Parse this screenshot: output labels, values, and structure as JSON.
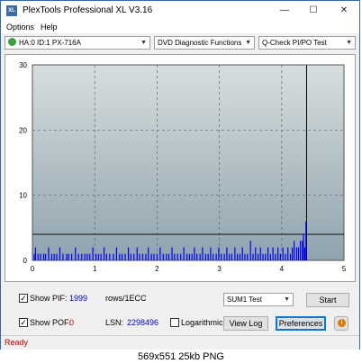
{
  "window": {
    "title": "PlexTools Professional XL V3.16",
    "icon_text": "XL"
  },
  "menu": {
    "options": "Options",
    "help": "Help"
  },
  "toolbar": {
    "drive": "HA:0 ID:1  PX-716A",
    "function": "DVD Diagnostic Functions",
    "test": "Q-Check PI/PO Test"
  },
  "chart_data": {
    "type": "bar",
    "x_ticks": [
      "0",
      "1",
      "2",
      "3",
      "4",
      "5"
    ],
    "y_ticks": [
      "0",
      "10",
      "20",
      "30"
    ],
    "xlim": [
      0,
      5
    ],
    "ylim": [
      0,
      30
    ],
    "grid": true,
    "threshold_line": 4,
    "end_marker_x": 4.4,
    "series": [
      {
        "color": "#0000ff",
        "points": [
          [
            0.03,
            1
          ],
          [
            0.05,
            2
          ],
          [
            0.09,
            1
          ],
          [
            0.13,
            1
          ],
          [
            0.18,
            1
          ],
          [
            0.21,
            1
          ],
          [
            0.26,
            2
          ],
          [
            0.31,
            1
          ],
          [
            0.35,
            1
          ],
          [
            0.39,
            1
          ],
          [
            0.44,
            2
          ],
          [
            0.49,
            1
          ],
          [
            0.55,
            1
          ],
          [
            0.58,
            1
          ],
          [
            0.63,
            1
          ],
          [
            0.69,
            2
          ],
          [
            0.74,
            1
          ],
          [
            0.79,
            1
          ],
          [
            0.84,
            1
          ],
          [
            0.88,
            1
          ],
          [
            0.92,
            1
          ],
          [
            0.97,
            2
          ],
          [
            1.02,
            1
          ],
          [
            1.06,
            1
          ],
          [
            1.1,
            1
          ],
          [
            1.15,
            2
          ],
          [
            1.19,
            1
          ],
          [
            1.24,
            1
          ],
          [
            1.3,
            1
          ],
          [
            1.35,
            2
          ],
          [
            1.4,
            1
          ],
          [
            1.44,
            1
          ],
          [
            1.49,
            1
          ],
          [
            1.54,
            2
          ],
          [
            1.58,
            1
          ],
          [
            1.63,
            1
          ],
          [
            1.68,
            2
          ],
          [
            1.72,
            1
          ],
          [
            1.77,
            1
          ],
          [
            1.82,
            1
          ],
          [
            1.86,
            2
          ],
          [
            1.91,
            1
          ],
          [
            1.95,
            1
          ],
          [
            2.0,
            1
          ],
          [
            2.05,
            2
          ],
          [
            2.1,
            1
          ],
          [
            2.15,
            1
          ],
          [
            2.19,
            1
          ],
          [
            2.24,
            2
          ],
          [
            2.28,
            1
          ],
          [
            2.33,
            1
          ],
          [
            2.38,
            1
          ],
          [
            2.43,
            2
          ],
          [
            2.48,
            1
          ],
          [
            2.52,
            1
          ],
          [
            2.56,
            1
          ],
          [
            2.6,
            2
          ],
          [
            2.64,
            1
          ],
          [
            2.69,
            1
          ],
          [
            2.73,
            2
          ],
          [
            2.78,
            1
          ],
          [
            2.82,
            1
          ],
          [
            2.86,
            2
          ],
          [
            2.9,
            1
          ],
          [
            2.95,
            1
          ],
          [
            2.99,
            2
          ],
          [
            3.03,
            1
          ],
          [
            3.08,
            1
          ],
          [
            3.12,
            2
          ],
          [
            3.16,
            1
          ],
          [
            3.2,
            1
          ],
          [
            3.25,
            2
          ],
          [
            3.29,
            1
          ],
          [
            3.33,
            1
          ],
          [
            3.37,
            2
          ],
          [
            3.41,
            1
          ],
          [
            3.45,
            1
          ],
          [
            3.5,
            3
          ],
          [
            3.54,
            1
          ],
          [
            3.58,
            2
          ],
          [
            3.62,
            1
          ],
          [
            3.66,
            2
          ],
          [
            3.7,
            1
          ],
          [
            3.74,
            1
          ],
          [
            3.78,
            2
          ],
          [
            3.82,
            1
          ],
          [
            3.86,
            2
          ],
          [
            3.9,
            1
          ],
          [
            3.94,
            2
          ],
          [
            3.98,
            1
          ],
          [
            4.02,
            2
          ],
          [
            4.06,
            1
          ],
          [
            4.1,
            2
          ],
          [
            4.14,
            1
          ],
          [
            4.17,
            2
          ],
          [
            4.2,
            3
          ],
          [
            4.24,
            2
          ],
          [
            4.27,
            2
          ],
          [
            4.3,
            3
          ],
          [
            4.33,
            3
          ],
          [
            4.35,
            4
          ],
          [
            4.37,
            2
          ],
          [
            4.39,
            6
          ]
        ]
      }
    ]
  },
  "controls": {
    "show_pif_label": "Show PIF:",
    "pif_value": "1999",
    "pif_unit": "rows/1ECC",
    "show_pof_label": "Show POF:",
    "pof_value": "0",
    "lsn_label": "LSN:",
    "lsn_value": "2298496",
    "logarithmic_label": "Logarithmic",
    "sum_select": "SUM1 Test",
    "start_button": "Start",
    "view_log_button": "View Log",
    "preferences_button": "Preferences",
    "check_mark": "✓"
  },
  "status": {
    "text": "Ready"
  },
  "caption": {
    "text": "569x551  25kb  PNG"
  },
  "colors": {
    "status_red": "#cc0000",
    "value_blue": "#0000cc",
    "value_red": "#cc0000",
    "plot_top": "#d7dede",
    "plot_bottom": "#8fa3ae",
    "bar_blue": "#0000ff"
  }
}
